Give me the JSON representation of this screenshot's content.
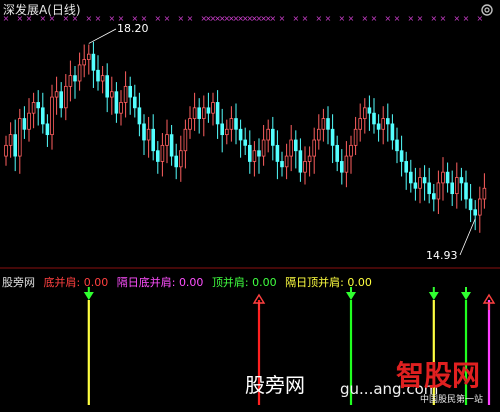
{
  "window": {
    "title": "深发展A(日线)",
    "settings_icon": "gear-icon"
  },
  "price_panel": {
    "high_label": "18.20",
    "low_label": "14.93",
    "price_range": [
      14.2,
      18.6
    ],
    "up_color": "#ff6060",
    "down_color": "#54ffff"
  },
  "indicator_row": {
    "name": "股旁网",
    "items": [
      {
        "label": "底并肩:",
        "value": "0.00",
        "color": "#ff4040"
      },
      {
        "label": "隔日底并肩:",
        "value": "0.00",
        "color": "#ff50ff"
      },
      {
        "label": "顶并肩:",
        "value": "0.00",
        "color": "#40ff40"
      },
      {
        "label": "隔日顶并肩:",
        "value": "0.00",
        "color": "#ffff40"
      }
    ]
  },
  "signals": [
    {
      "bar": 18,
      "kind": "green_down",
      "line_color": "#ffff40"
    },
    {
      "bar": 55,
      "kind": "red_up",
      "line_color": "#ff2020"
    },
    {
      "bar": 75,
      "kind": "green_down",
      "line_color": "#20ff20"
    },
    {
      "bar": 93,
      "kind": "green_down",
      "line_color": "#ffff40"
    },
    {
      "bar": 100,
      "kind": "green_down",
      "line_color": "#20ff20"
    },
    {
      "bar": 105,
      "kind": "red_up",
      "line_color": "#ff40ff"
    }
  ],
  "watermark": {
    "text": "股旁网",
    "url": "gu...ang.com",
    "logo": "智股网",
    "slogan": "中国股民第一站"
  },
  "chart_data": {
    "type": "candlestick",
    "title": "深发展A(日线)",
    "high_annotation": 18.2,
    "low_annotation": 14.93,
    "closes": [
      16.3,
      16.5,
      16.1,
      16.8,
      16.6,
      16.9,
      17.1,
      17.0,
      16.7,
      16.5,
      17.2,
      17.3,
      17.0,
      17.4,
      17.6,
      17.5,
      17.8,
      17.9,
      18.0,
      17.7,
      17.5,
      17.6,
      17.2,
      17.3,
      16.9,
      17.1,
      17.4,
      17.2,
      17.0,
      16.7,
      16.4,
      16.6,
      16.2,
      16.0,
      16.3,
      16.5,
      16.1,
      15.9,
      16.2,
      16.6,
      16.8,
      17.0,
      16.8,
      17.0,
      16.9,
      17.1,
      16.7,
      16.5,
      16.6,
      16.8,
      16.6,
      16.4,
      16.3,
      16.0,
      16.2,
      16.1,
      16.4,
      16.6,
      16.3,
      16.0,
      15.9,
      16.1,
      16.4,
      16.2,
      15.8,
      16.0,
      16.1,
      16.4,
      16.6,
      16.8,
      16.6,
      16.3,
      16.0,
      15.8,
      16.1,
      16.3,
      16.6,
      16.8,
      17.0,
      16.9,
      16.7,
      16.6,
      16.8,
      16.7,
      16.4,
      16.2,
      16.0,
      15.8,
      15.6,
      15.5,
      15.7,
      15.6,
      15.4,
      15.3,
      15.6,
      15.8,
      15.6,
      15.4,
      15.7,
      15.6,
      15.3,
      15.1,
      15.0,
      15.3,
      15.5
    ]
  }
}
